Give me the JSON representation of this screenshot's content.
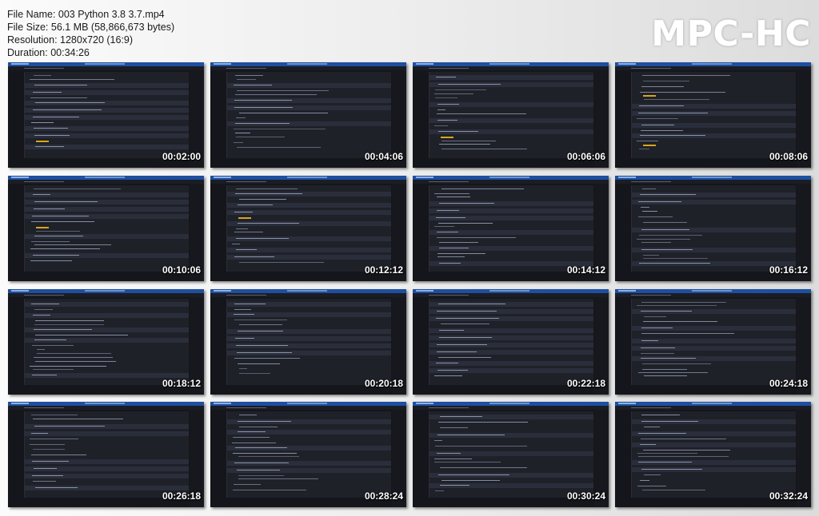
{
  "info": {
    "file_name": "File Name: 003 Python 3.8  3.7.mp4",
    "file_size": "File Size: 56.1 MB (58,866,673 bytes)",
    "resolution": "Resolution: 1280x720 (16:9)",
    "duration": "Duration: 00:34:26"
  },
  "logo": "MPC-HC",
  "thumbnails": [
    {
      "time": "00:02:00"
    },
    {
      "time": "00:04:06"
    },
    {
      "time": "00:06:06"
    },
    {
      "time": "00:08:06"
    },
    {
      "time": "00:10:06"
    },
    {
      "time": "00:12:12"
    },
    {
      "time": "00:14:12"
    },
    {
      "time": "00:16:12"
    },
    {
      "time": "00:18:12"
    },
    {
      "time": "00:20:18"
    },
    {
      "time": "00:22:18"
    },
    {
      "time": "00:24:18"
    },
    {
      "time": "00:26:18"
    },
    {
      "time": "00:28:24"
    },
    {
      "time": "00:30:24"
    },
    {
      "time": "00:32:24"
    }
  ],
  "colors": {
    "window_titlebar": "#1e4fa0",
    "editor_background": "#1f2129",
    "highlight": "#d8a61c",
    "timestamp": "#ffffff",
    "logo": "#ffffff"
  }
}
